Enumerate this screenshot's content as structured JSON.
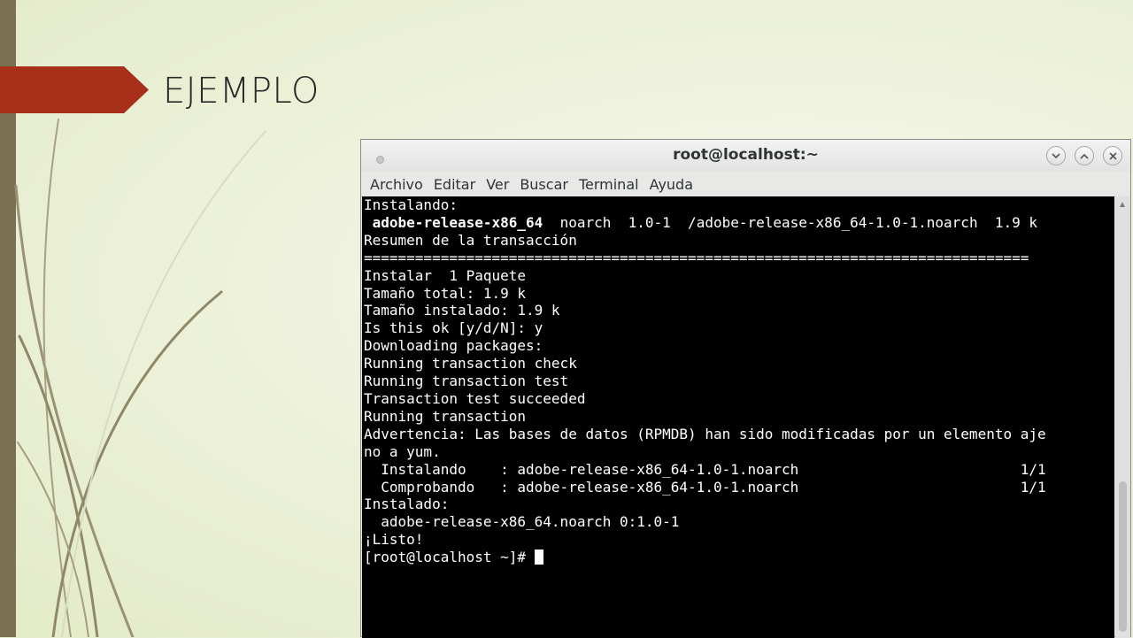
{
  "slide": {
    "title": "EJEMPLO"
  },
  "window": {
    "title": "root@localhost:~",
    "menu": [
      "Archivo",
      "Editar",
      "Ver",
      "Buscar",
      "Terminal",
      "Ayuda"
    ]
  },
  "terminal": {
    "lines": [
      "Instalando:",
      " adobe-release-x86_64  noarch  1.0-1  /adobe-release-x86_64-1.0-1.noarch  1.9 k",
      "",
      "Resumen de la transacción",
      "==============================================================================",
      "Instalar  1 Paquete",
      "",
      "Tamaño total: 1.9 k",
      "Tamaño instalado: 1.9 k",
      "Is this ok [y/d/N]: y",
      "Downloading packages:",
      "Running transaction check",
      "Running transaction test",
      "Transaction test succeeded",
      "Running transaction",
      "Advertencia: Las bases de datos (RPMDB) han sido modificadas por un elemento aje",
      "no a yum.",
      "  Instalando    : adobe-release-x86_64-1.0-1.noarch                          1/1",
      "  Comprobando   : adobe-release-x86_64-1.0-1.noarch                          1/1",
      "",
      "Instalado:",
      "  adobe-release-x86_64.noarch 0:1.0-1",
      "",
      "¡Listo!"
    ],
    "pkg_name": "adobe-release-x86_64",
    "pkg_rest": "  noarch  1.0-1  /adobe-release-x86_64-1.0-1.noarch  1.9 k",
    "prompt": "[root@localhost ~]# "
  },
  "colors": {
    "banner": "#a8301a",
    "left_bar": "#7a7155",
    "terminal_bg": "#000000",
    "terminal_fg": "#ffffff"
  }
}
